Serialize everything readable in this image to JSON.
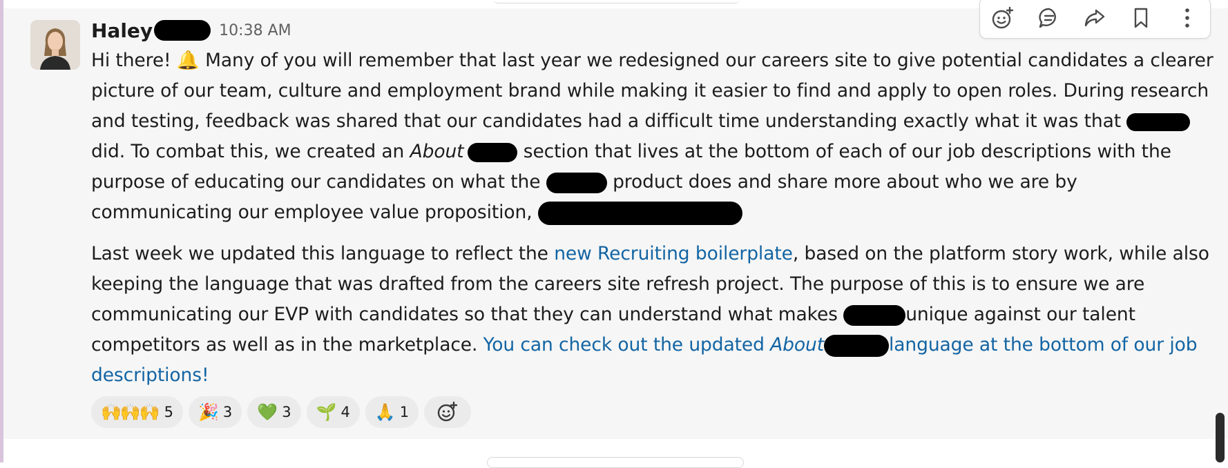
{
  "message": {
    "author": "Haley",
    "timestamp": "10:38 AM",
    "p1": {
      "l1a": "Hi there! ",
      "l1b": " Many of you will remember that last year we redesigned our careers site to give potential candidates a clearer",
      "l2": "picture of our team, culture and employment brand while making it easier to find and apply to open roles. During research",
      "l3": "and testing, feedback was shared that our candidates had a difficult time understanding exactly what it was that ",
      "l4a": "did. To combat this, we created an ",
      "l4_about": "About",
      "l4b": " section that lives at the bottom of each of our job descriptions with the",
      "l5a": "purpose of educating our candidates on what the ",
      "l5b": " product does and share more about who we are by",
      "l6a": "communicating our employee value proposition, "
    },
    "p2": {
      "l1a": "Last week we updated this language to reflect the ",
      "l1_link": "new Recruiting boilerplate",
      "l1b": ", based on the platform story work, while also",
      "l2": "keeping the language that was drafted from the careers site refresh project. The purpose of this is to ensure we are",
      "l3a": "communicating our EVP with candidates so that they can understand what makes ",
      "l3b": "unique against our talent",
      "l4a": "competitors as well as in the marketplace. ",
      "l4_link_a": "You can check out the updated ",
      "l4_link_about": "About",
      "l4_link_b": "language at the bottom of our job",
      "l5_link": "descriptions!"
    }
  },
  "reactions": [
    {
      "emoji": "🙌🙌🙌",
      "count": "5"
    },
    {
      "emoji": "🎉",
      "count": "3"
    },
    {
      "emoji": "💚",
      "count": "3"
    },
    {
      "emoji": "🌱",
      "count": "4"
    },
    {
      "emoji": "🙏",
      "count": "1"
    }
  ],
  "icons": {
    "toolbar": [
      "add-reaction-icon",
      "reply-thread-icon",
      "share-icon",
      "bookmark-icon",
      "more-actions-icon"
    ],
    "add_reaction": "add-reaction-icon"
  },
  "colors": {
    "link": "#1264a3",
    "message_bg": "#f6f6f6",
    "reaction_bg": "#ebebeb"
  }
}
